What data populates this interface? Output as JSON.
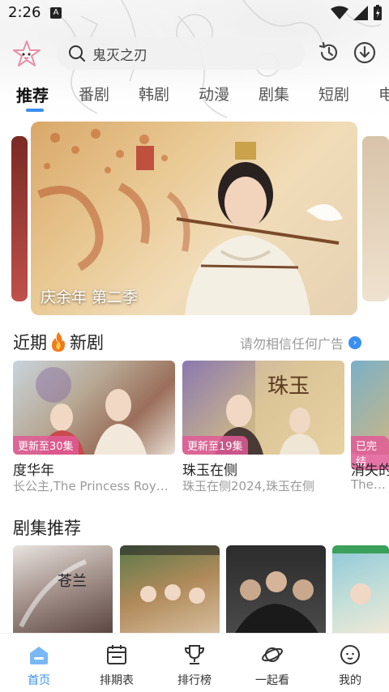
{
  "status_bar": {
    "time": "2:26",
    "notification_badge": "A"
  },
  "search": {
    "placeholder_value": "鬼灭之刃"
  },
  "tabs": [
    {
      "label": "推荐"
    },
    {
      "label": "番剧"
    },
    {
      "label": "韩剧"
    },
    {
      "label": "动漫"
    },
    {
      "label": "剧集"
    },
    {
      "label": "短剧"
    },
    {
      "label": "电"
    }
  ],
  "banner": {
    "title": "庆余年 第二季"
  },
  "recent": {
    "title_part1": "近期",
    "title_part2": "新剧",
    "ad_note": "请勿相信任何广告",
    "cards": [
      {
        "badge": "更新至30集",
        "title": "度华年",
        "subtitle": "长公主,The Princess Royal..."
      },
      {
        "badge": "更新至19集",
        "title": "珠玉在侧",
        "subtitle": "珠玉在侧2024,珠玉在侧"
      },
      {
        "badge": "已完结",
        "title": "消失的",
        "subtitle": "The Va"
      }
    ]
  },
  "drama": {
    "title": "剧集推荐"
  },
  "bottom_nav": [
    {
      "label": "首页",
      "icon": "home-icon"
    },
    {
      "label": "排期表",
      "icon": "calendar-icon"
    },
    {
      "label": "排行榜",
      "icon": "trophy-icon"
    },
    {
      "label": "一起看",
      "icon": "planet-icon"
    },
    {
      "label": "我的",
      "icon": "profile-icon"
    }
  ],
  "colors": {
    "accent": "#3a8ff0",
    "badge": "#e15a96"
  }
}
